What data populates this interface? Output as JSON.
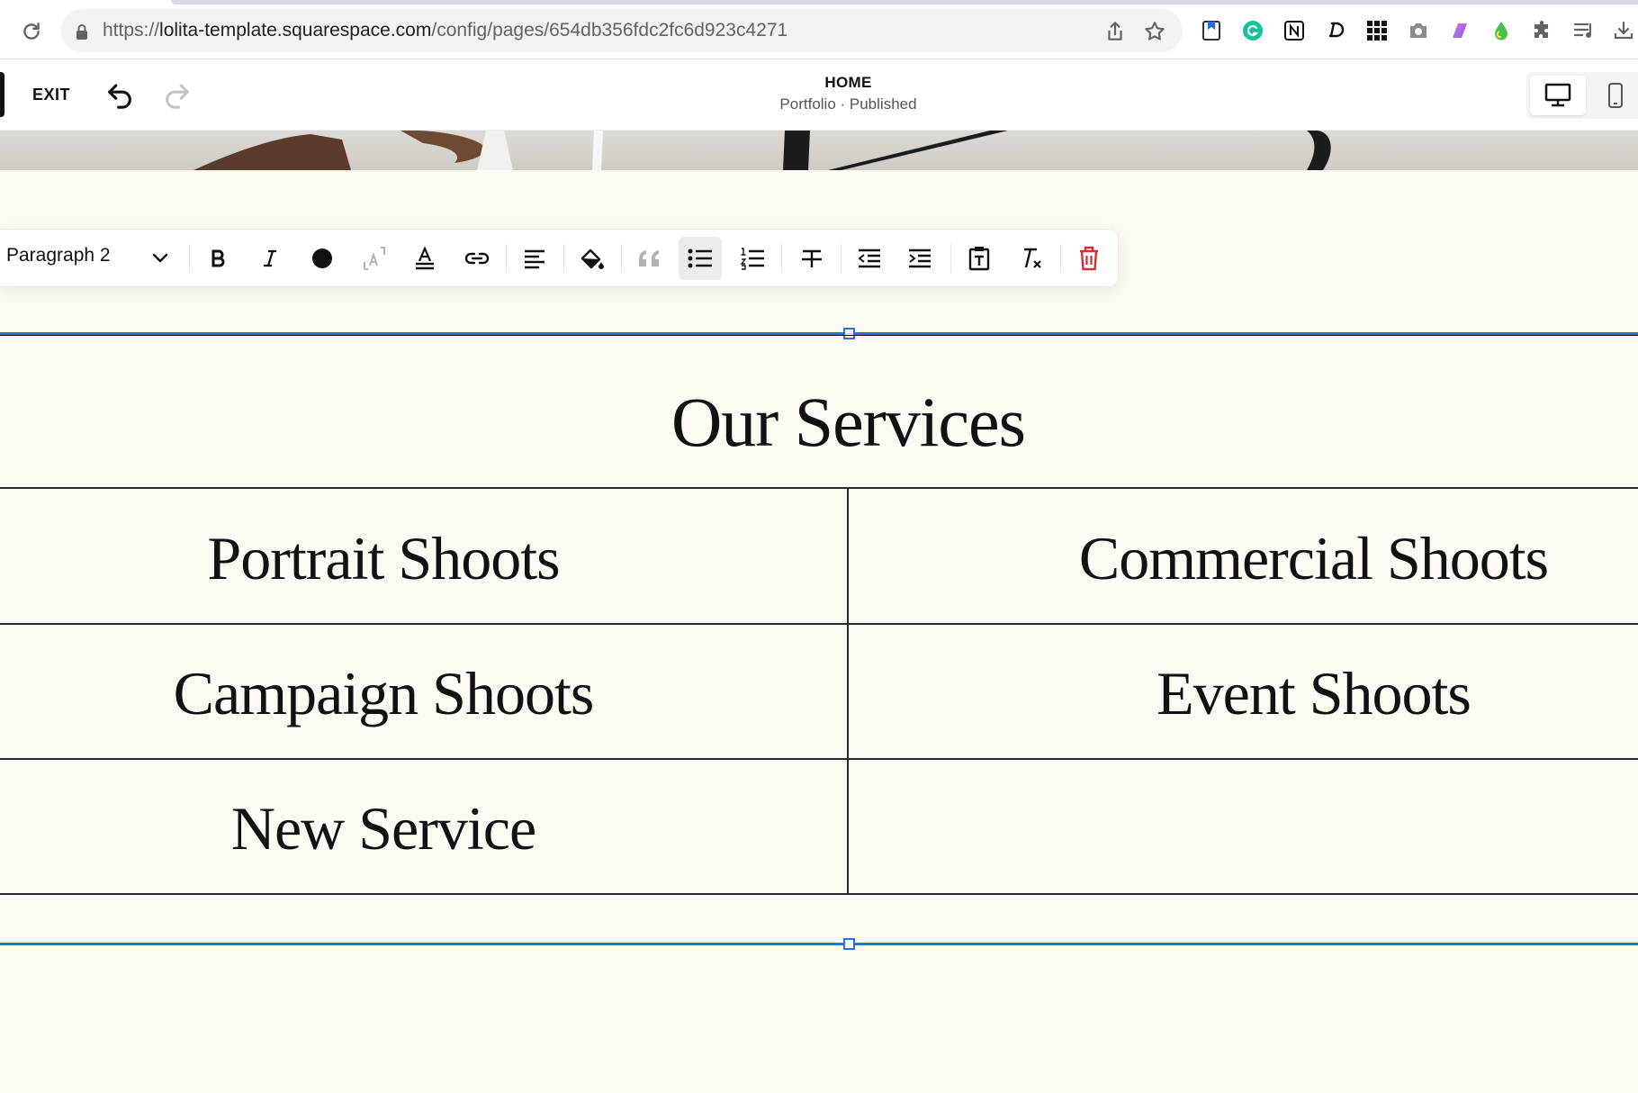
{
  "browser": {
    "url_prefix": "https://",
    "url_host": "lolita-template.squarespace.com",
    "url_path": "/config/pages/654db356fdc2fc6d923c4271",
    "icons": [
      "reload-icon",
      "lock-icon",
      "share-icon",
      "bookmark-star-icon"
    ],
    "extensions": [
      "bookmark-ext-icon",
      "grammarly-icon",
      "notion-icon",
      "d-ext-icon",
      "grid-ext-icon",
      "camera-ext-icon",
      "gradient-ext-icon",
      "drop-ext-icon",
      "puzzle-icon",
      "media-list-icon",
      "download-icon"
    ]
  },
  "editor": {
    "exit_label": "EXIT",
    "page_title": "HOME",
    "page_subtitle": "Portfolio · Published",
    "devices": [
      "desktop",
      "mobile"
    ],
    "active_device": "desktop"
  },
  "toolbar": {
    "style_value": "Paragraph 2",
    "buttons": [
      "bold",
      "italic",
      "text-color",
      "superscript",
      "text-highlight",
      "link",
      "align-left",
      "fill-color",
      "blockquote",
      "bulleted-list",
      "numbered-list",
      "strikethrough",
      "outdent",
      "indent",
      "paste",
      "clear-format",
      "delete"
    ],
    "active_button": "bulleted-list",
    "accent": "#d0312d"
  },
  "section": {
    "title": "Our Services",
    "rows": [
      [
        "Portrait Shoots",
        "Commercial Shoots"
      ],
      [
        "Campaign Shoots",
        "Event Shoots"
      ],
      [
        "New Service",
        ""
      ]
    ],
    "guide_color": "#2574e0",
    "background": "#fdf9f3"
  }
}
